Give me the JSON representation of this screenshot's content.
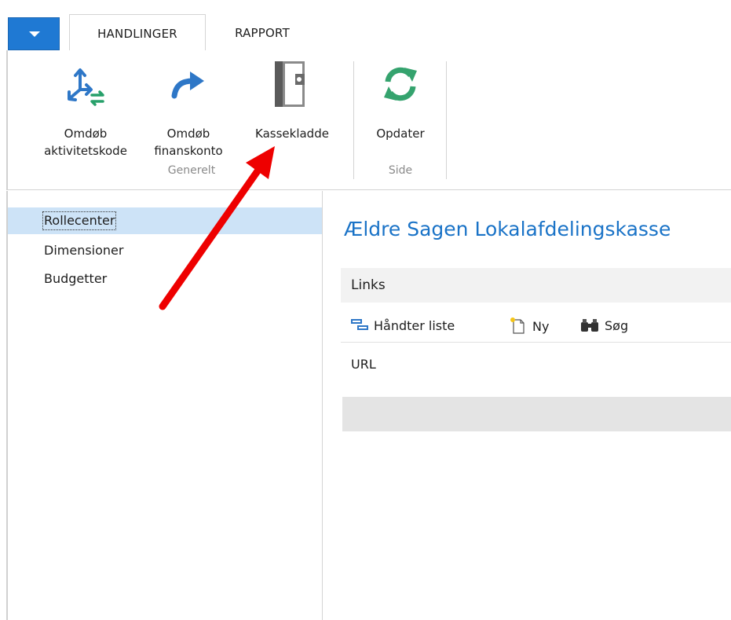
{
  "tabs": [
    {
      "label": "HANDLINGER",
      "active": true
    },
    {
      "label": "RAPPORT",
      "active": false
    }
  ],
  "app_menu": {
    "icon": "chevron-down-icon",
    "color": "#1f79d3"
  },
  "ribbon": {
    "groups": [
      {
        "label": "Generelt"
      },
      {
        "label": "Side"
      }
    ],
    "buttons": [
      {
        "label": "Omdøb\naktivitetskode",
        "line1": "Omdøb",
        "line2": "aktivitetskode",
        "icon": "rename-dimension-icon"
      },
      {
        "label": "Omdøb\nfinanskonto",
        "line1": "Omdøb",
        "line2": "finanskonto",
        "icon": "forward-arrow-icon"
      },
      {
        "label": "Kassekladde",
        "icon": "journal-book-icon"
      },
      {
        "label": "Opdater",
        "icon": "refresh-icon"
      }
    ]
  },
  "nav": {
    "items": [
      {
        "label": "Rollecenter",
        "selected": true
      },
      {
        "label": "Dimensioner",
        "selected": false
      },
      {
        "label": "Budgetter",
        "selected": false
      }
    ]
  },
  "main": {
    "title": "Ældre Sagen Lokalafdelingskasse",
    "links_part": {
      "header": "Links",
      "toolbar": [
        {
          "label": "Håndter liste",
          "icon": "manage-list-icon"
        },
        {
          "label": "Ny",
          "icon": "new-document-icon"
        },
        {
          "label": "Søg",
          "icon": "binoculars-icon"
        }
      ],
      "columns": [
        "URL"
      ]
    }
  },
  "colors": {
    "accent": "#1f79d3",
    "title": "#1a73c7",
    "selection": "#cde3f7",
    "annotation": "#ee0000"
  }
}
